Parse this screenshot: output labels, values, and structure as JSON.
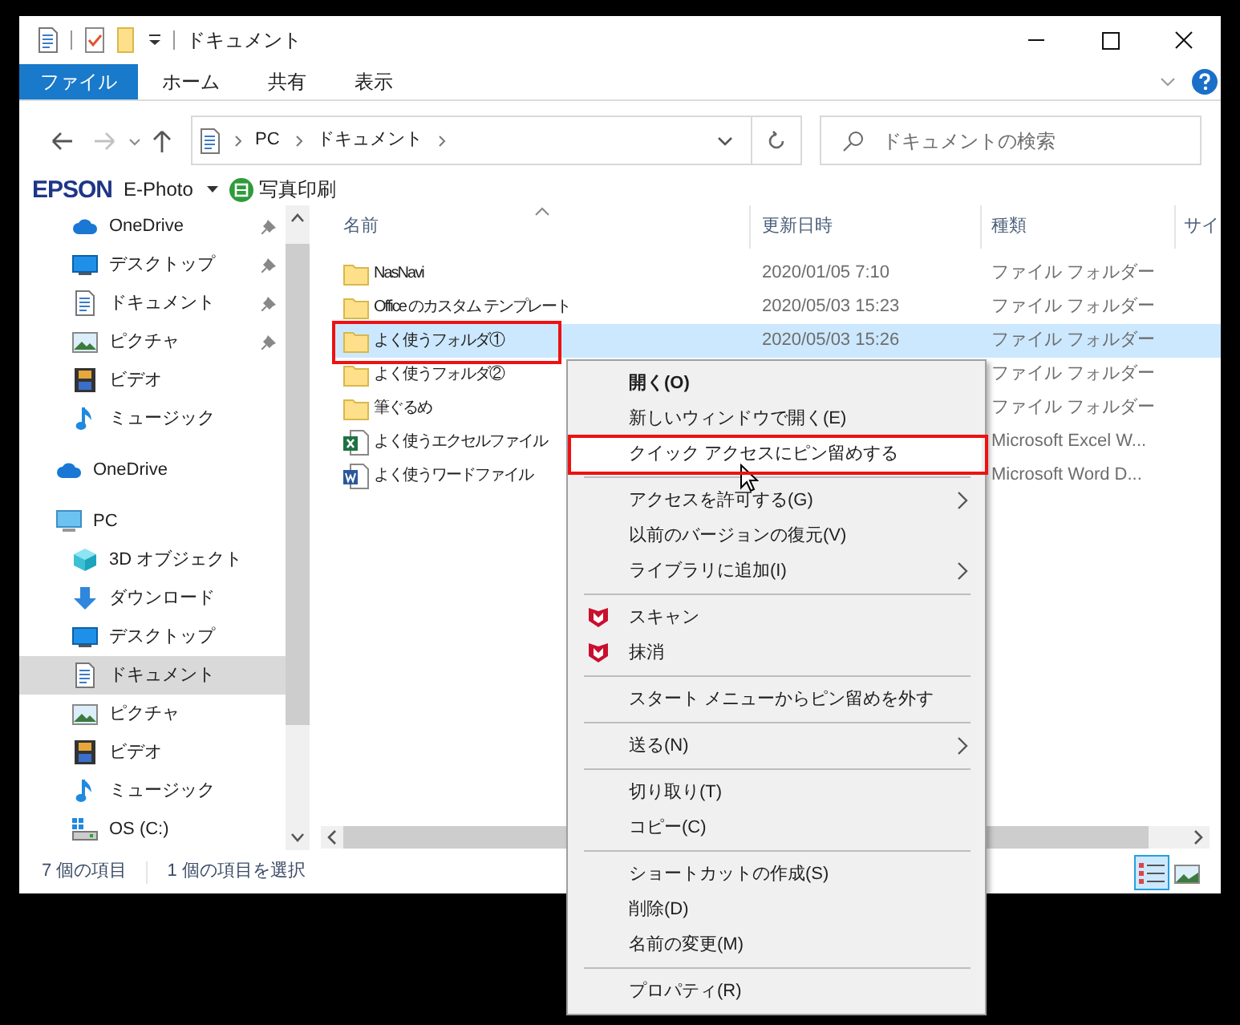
{
  "window": {
    "title": "ドキュメント"
  },
  "ribbon_tabs": [
    {
      "label": "ファイル",
      "selected": true
    },
    {
      "label": "ホーム",
      "selected": false
    },
    {
      "label": "共有",
      "selected": false
    },
    {
      "label": "表示",
      "selected": false
    }
  ],
  "address": {
    "path": [
      "PC",
      "ドキュメント"
    ]
  },
  "search": {
    "placeholder": "ドキュメントの検索"
  },
  "toolbar": {
    "brand": "EPSON",
    "app": "E-Photo",
    "action": "写真印刷"
  },
  "quick_access": [
    {
      "label": "OneDrive",
      "kind": "cloud",
      "pinned": true,
      "selected": false
    },
    {
      "label": "デスクトップ",
      "kind": "desktop",
      "pinned": true,
      "selected": false
    },
    {
      "label": "ドキュメント",
      "kind": "document",
      "pinned": true,
      "selected": false
    },
    {
      "label": "ピクチャ",
      "kind": "pictures",
      "pinned": true,
      "selected": false
    },
    {
      "label": "ビデオ",
      "kind": "video",
      "pinned": false,
      "selected": false
    },
    {
      "label": "ミュージック",
      "kind": "music",
      "pinned": false,
      "selected": false
    }
  ],
  "tree": [
    {
      "label": "OneDrive",
      "kind": "cloud",
      "selected": false
    },
    {
      "label": "PC",
      "kind": "pc",
      "selected": false,
      "children": [
        {
          "label": "3D オブジェクト",
          "kind": "cube",
          "selected": false
        },
        {
          "label": "ダウンロード",
          "kind": "download",
          "selected": false
        },
        {
          "label": "デスクトップ",
          "kind": "desktop",
          "selected": false
        },
        {
          "label": "ドキュメント",
          "kind": "document",
          "selected": true
        },
        {
          "label": "ピクチャ",
          "kind": "pictures",
          "selected": false
        },
        {
          "label": "ビデオ",
          "kind": "video",
          "selected": false
        },
        {
          "label": "ミュージック",
          "kind": "music",
          "selected": false
        },
        {
          "label": "OS (C:)",
          "kind": "drive",
          "selected": false
        }
      ]
    }
  ],
  "columns": [
    "名前",
    "更新日時",
    "種類",
    "サイ"
  ],
  "files": [
    {
      "name": "NasNavi",
      "kind": "folder",
      "modified": "2020/01/05 7:10",
      "type": "ファイル フォルダー",
      "selected": false,
      "marked": false
    },
    {
      "name": "Office のカスタム テンプレート",
      "kind": "folder",
      "modified": "2020/05/03 15:23",
      "type": "ファイル フォルダー",
      "selected": false,
      "marked": false
    },
    {
      "name": "よく使うフォルダ①",
      "kind": "folder",
      "modified": "2020/05/03 15:26",
      "type": "ファイル フォルダー",
      "selected": true,
      "marked": true
    },
    {
      "name": "よく使うフォルダ②",
      "kind": "folder",
      "type": "ファイル フォルダー",
      "selected": false,
      "marked": false
    },
    {
      "name": "筆ぐるめ",
      "kind": "folder",
      "type": "ファイル フォルダー",
      "selected": false,
      "marked": false
    },
    {
      "name": "よく使うエクセルファイル",
      "kind": "excel",
      "type": "Microsoft Excel W...",
      "selected": false,
      "marked": false
    },
    {
      "name": "よく使うワードファイル",
      "kind": "word",
      "type": "Microsoft Word D...",
      "selected": false,
      "marked": false
    }
  ],
  "menu": {
    "groups": [
      [
        {
          "label": "開く(O)",
          "kind": "bold",
          "hovered": false,
          "marked": false
        },
        {
          "label": "新しいウィンドウで開く(E)",
          "kind": "plain",
          "hovered": false,
          "marked": false
        },
        {
          "label": "クイック アクセスにピン留めする",
          "kind": "plain",
          "hovered": true,
          "marked": true
        }
      ],
      [
        {
          "label": "アクセスを許可する(G)",
          "kind": "submenu",
          "hovered": false,
          "marked": false
        },
        {
          "label": "以前のバージョンの復元(V)",
          "kind": "plain",
          "hovered": false,
          "marked": false
        },
        {
          "label": "ライブラリに追加(I)",
          "kind": "submenu",
          "hovered": false,
          "marked": false
        }
      ],
      [
        {
          "label": "スキャン",
          "kind": "shield",
          "hovered": false,
          "marked": false
        },
        {
          "label": "抹消",
          "kind": "shield",
          "hovered": false,
          "marked": false
        }
      ],
      [
        {
          "label": "スタート メニューからピン留めを外す",
          "kind": "plain",
          "hovered": false,
          "marked": false
        }
      ],
      [
        {
          "label": "送る(N)",
          "kind": "submenu",
          "hovered": false,
          "marked": false
        }
      ],
      [
        {
          "label": "切り取り(T)",
          "kind": "plain",
          "hovered": false,
          "marked": false
        },
        {
          "label": "コピー(C)",
          "kind": "plain",
          "hovered": false,
          "marked": false
        }
      ],
      [
        {
          "label": "ショートカットの作成(S)",
          "kind": "plain",
          "hovered": false,
          "marked": false
        },
        {
          "label": "削除(D)",
          "kind": "plain",
          "hovered": false,
          "marked": false
        },
        {
          "label": "名前の変更(M)",
          "kind": "plain",
          "hovered": false,
          "marked": false
        }
      ],
      [
        {
          "label": "プロパティ(R)",
          "kind": "plain",
          "hovered": false,
          "marked": false
        }
      ]
    ]
  },
  "status": {
    "count": "7 個の項目",
    "selection": "1 個の項目を選択"
  },
  "views": [
    {
      "kind": "details",
      "selected": true
    },
    {
      "kind": "tiles",
      "selected": false
    }
  ]
}
